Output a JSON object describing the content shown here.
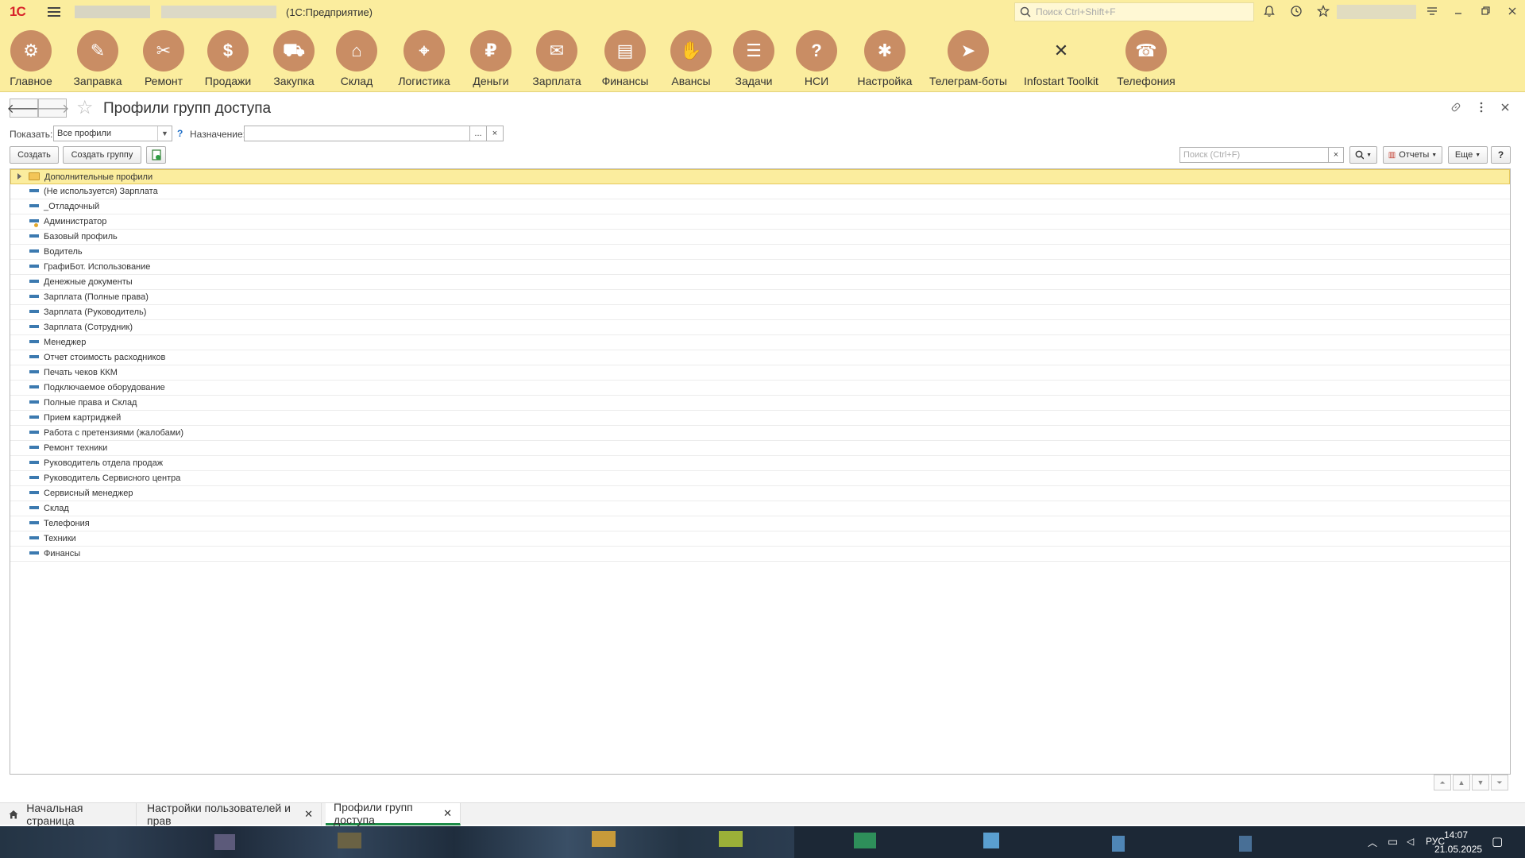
{
  "titlebar": {
    "app_title": "(1С:Предприятие)",
    "search_placeholder": "Поиск Ctrl+Shift+F",
    "icons": [
      "search-icon",
      "bell-icon",
      "history-icon",
      "star-icon",
      "menu-icon",
      "minimize-icon",
      "restore-icon",
      "close-icon"
    ]
  },
  "sections": [
    {
      "label": "Главное",
      "icon": "gear-icon"
    },
    {
      "label": "Заправка",
      "icon": "cartridge-icon"
    },
    {
      "label": "Ремонт",
      "icon": "tools-icon"
    },
    {
      "label": "Продажи",
      "icon": "sale-icon"
    },
    {
      "label": "Закупка",
      "icon": "cart-icon"
    },
    {
      "label": "Склад",
      "icon": "warehouse-icon"
    },
    {
      "label": "Логистика",
      "icon": "map-icon"
    },
    {
      "label": "Деньги",
      "icon": "money-bag-icon"
    },
    {
      "label": "Зарплата",
      "icon": "salary-icon"
    },
    {
      "label": "Финансы",
      "icon": "finance-icon"
    },
    {
      "label": "Авансы",
      "icon": "advance-icon"
    },
    {
      "label": "Задачи",
      "icon": "tasks-icon"
    },
    {
      "label": "НСИ",
      "icon": "reference-icon"
    },
    {
      "label": "Настройка",
      "icon": "settings-icon"
    },
    {
      "label": "Телеграм-боты",
      "icon": "telegram-icon"
    },
    {
      "label": "Infostart Toolkit",
      "icon": "toolkit-icon"
    },
    {
      "label": "Телефония",
      "icon": "phone-icon"
    }
  ],
  "form": {
    "title": "Профили групп доступа"
  },
  "filters": {
    "show_label": "Показать:",
    "show_value": "Все профили",
    "help": "?",
    "purpose_label": "Назначение:",
    "purpose_value": "",
    "ellipsis": "...",
    "clear": "×"
  },
  "commands": {
    "create": "Создать",
    "create_group": "Создать группу",
    "search_placeholder": "Поиск (Ctrl+F)",
    "clear": "×",
    "reports": "Отчеты",
    "more": "Еще",
    "help": "?"
  },
  "list": {
    "group": "Дополнительные профили",
    "items": [
      "(Не используется) Зарплата",
      "_Отладочный",
      "Администратор",
      "Базовый профиль",
      "Водитель",
      "ГрафиБот. Использование",
      "Денежные документы",
      "Зарплата (Полные права)",
      "Зарплата (Руководитель)",
      "Зарплата (Сотрудник)",
      "Менеджер",
      "Отчет стоимость расходников",
      "Печать чеков ККМ",
      "Подключаемое оборудование",
      "Полные права и Склад",
      "Прием картриджей",
      "Работа с претензиями (жалобами)",
      "Ремонт техники",
      "Руководитель отдела продаж",
      "Руководитель Сервисного центра",
      "Сервисный менеджер",
      "Склад",
      "Телефония",
      "Техники",
      "Финансы"
    ]
  },
  "open_tabs": [
    {
      "label": "Начальная страница"
    },
    {
      "label": "Настройки пользователей и прав"
    },
    {
      "label": "Профили групп доступа"
    }
  ],
  "taskbar": {
    "language": "РУС",
    "time": "14:07",
    "date": "21.05.2025"
  }
}
